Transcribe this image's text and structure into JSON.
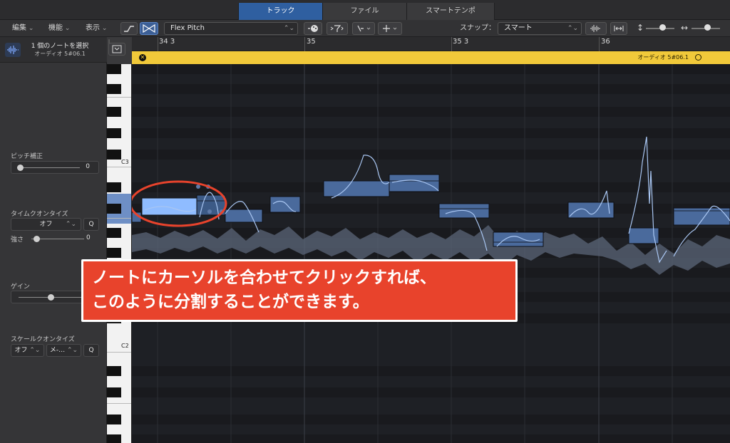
{
  "tabs": [
    {
      "label": "トラック",
      "active": true
    },
    {
      "label": "ファイル",
      "active": false
    },
    {
      "label": "スマートテンポ",
      "active": false
    }
  ],
  "toolbar": {
    "menus": [
      "編集",
      "機能",
      "表示"
    ],
    "mode_select": "Flex Pitch",
    "snap_label": "スナップ：",
    "snap_value": "スマート"
  },
  "inspector": {
    "selection_title": "1 個のノートを選択",
    "selection_subtitle": "オーディオ 5#06.1",
    "pitch_correction": {
      "label": "ピッチ補正",
      "value": "0",
      "level": 0
    },
    "time_quantize": {
      "label": "タイムクオンタイズ",
      "mode": "オフ",
      "q_button": "Q",
      "strength_label": "強さ",
      "strength_value": "0"
    },
    "gain": {
      "label": "ゲイン",
      "level": 0.45
    },
    "scale_quantize": {
      "label": "スケールクオンタイズ",
      "mode": "オフ",
      "scale": "メ-…",
      "q_button": "Q"
    }
  },
  "keyboard": {
    "labels": [
      "C3",
      "C2"
    ]
  },
  "ruler": {
    "bars": [
      "34 3",
      "35",
      "35 3",
      "36"
    ]
  },
  "region": {
    "title": "オーディオ 5#06.1"
  },
  "annotation": {
    "line1": "ノートにカーソルを合わせてクリックすれば、",
    "line2": "このように分割することができます。"
  },
  "colors": {
    "accent": "#2f5fa0",
    "region_yellow": "#f1c93a",
    "note_fill": "#4a6a9c",
    "selected_note": "#8fbcff",
    "annotation_red": "#e8432c",
    "highlight_ring": "#e8432c"
  }
}
